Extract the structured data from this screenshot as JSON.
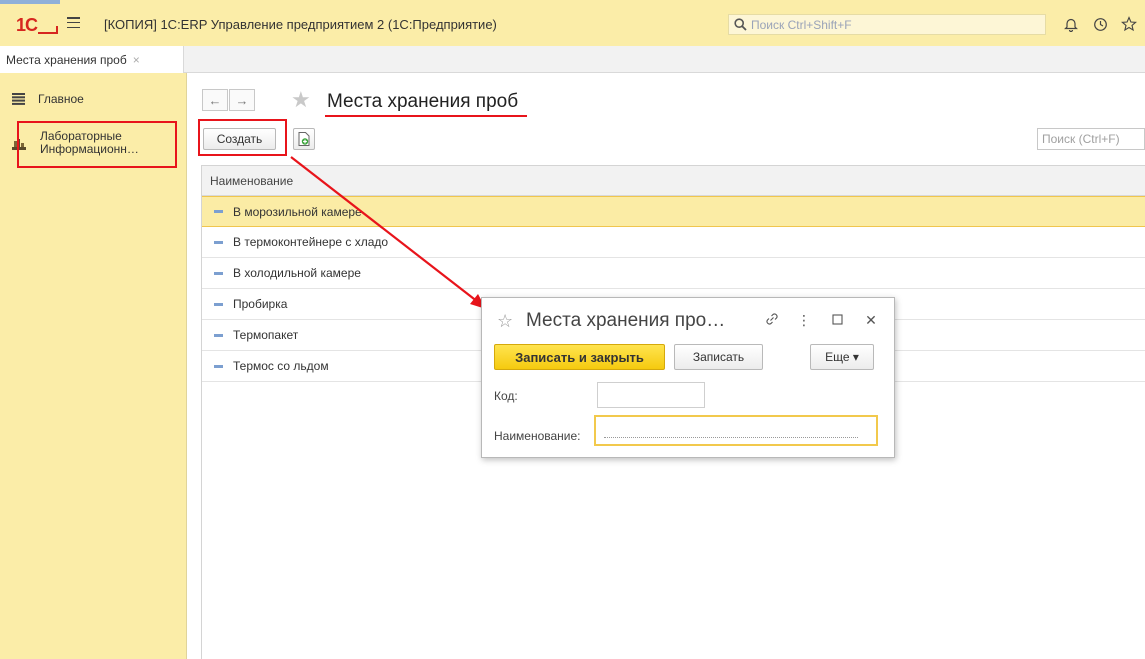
{
  "titlebar": {
    "logo": "1С",
    "app_title": "[КОПИЯ] 1С:ERP Управление предприятием 2  (1С:Предприятие)",
    "search_placeholder": "Поиск Ctrl+Shift+F",
    "icons": [
      "bell-icon",
      "history-icon",
      "star-icon"
    ]
  },
  "tabs": [
    {
      "label": "Места хранения проб",
      "close": "×"
    }
  ],
  "sidebar": {
    "items": [
      {
        "label": "Главное",
        "icon": "menu-lines-icon"
      },
      {
        "label_line1": "Лабораторные",
        "label_line2": "Информационн…",
        "icon": "lab-icon"
      }
    ]
  },
  "main": {
    "title": "Места хранения проб",
    "nav_back": "←",
    "nav_forward": "→",
    "create_label": "Создать",
    "search_placeholder": "Поиск (Ctrl+F)",
    "column_header": "Наименование",
    "rows": [
      "В морозильной камере",
      "В термоконтейнере с хладо",
      "В холодильной камере",
      "Пробирка",
      "Термопакет",
      "Термос со льдом"
    ],
    "selected_row": 0
  },
  "dialog": {
    "title": "Места хранения про…",
    "save_close_label": "Записать и закрыть",
    "save_label": "Записать",
    "more_label": "Еще ▾",
    "code_label": "Код:",
    "code_value": "",
    "name_label": "Наименование:",
    "name_value": ""
  },
  "colors": {
    "panel_yellow": "#fbeda8",
    "annotation_red": "#e8141b",
    "primary_button": "#f9d51c",
    "selected_row": "#fbeca5"
  }
}
